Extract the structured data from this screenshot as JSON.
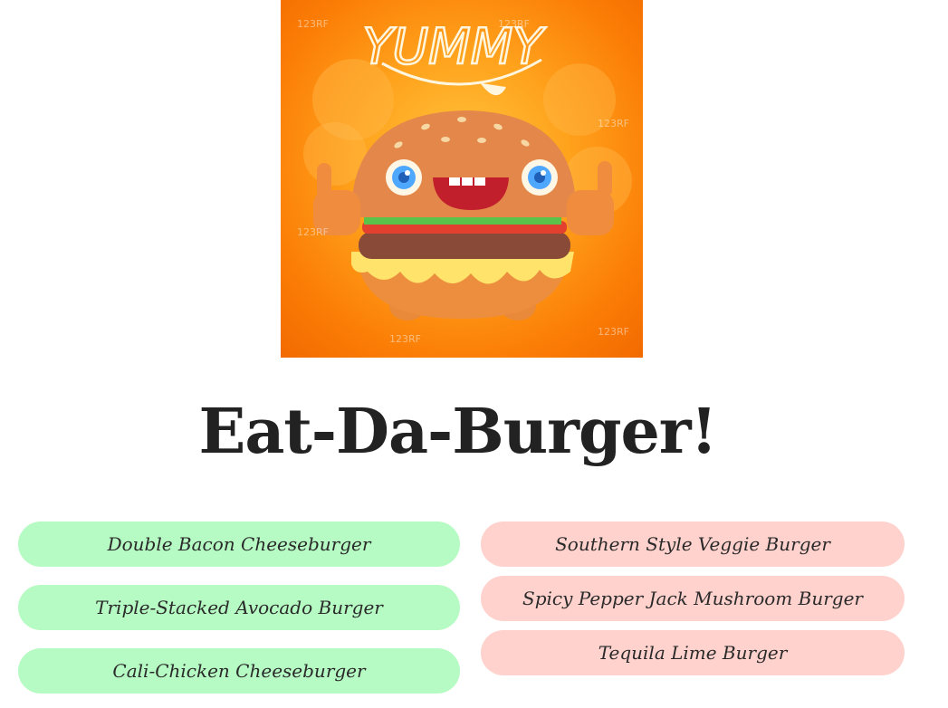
{
  "hero": {
    "yummy_text": "YUMMY",
    "watermark": "123RF"
  },
  "title": "Eat-Da-Burger!",
  "not_devoured": [
    {
      "label": "Double Bacon Cheeseburger"
    },
    {
      "label": "Triple-Stacked Avocado Burger"
    },
    {
      "label": "Cali-Chicken Cheeseburger"
    }
  ],
  "devoured": [
    {
      "label": "Southern Style Veggie Burger"
    },
    {
      "label": "Spicy Pepper Jack Mushroom Burger"
    },
    {
      "label": "Tequila Lime Burger"
    }
  ],
  "colors": {
    "not_devoured_bg": "#b6fbc3",
    "devoured_bg": "#ffd2cd",
    "hero_orange": "#fb7d06",
    "title_color": "#222222"
  }
}
